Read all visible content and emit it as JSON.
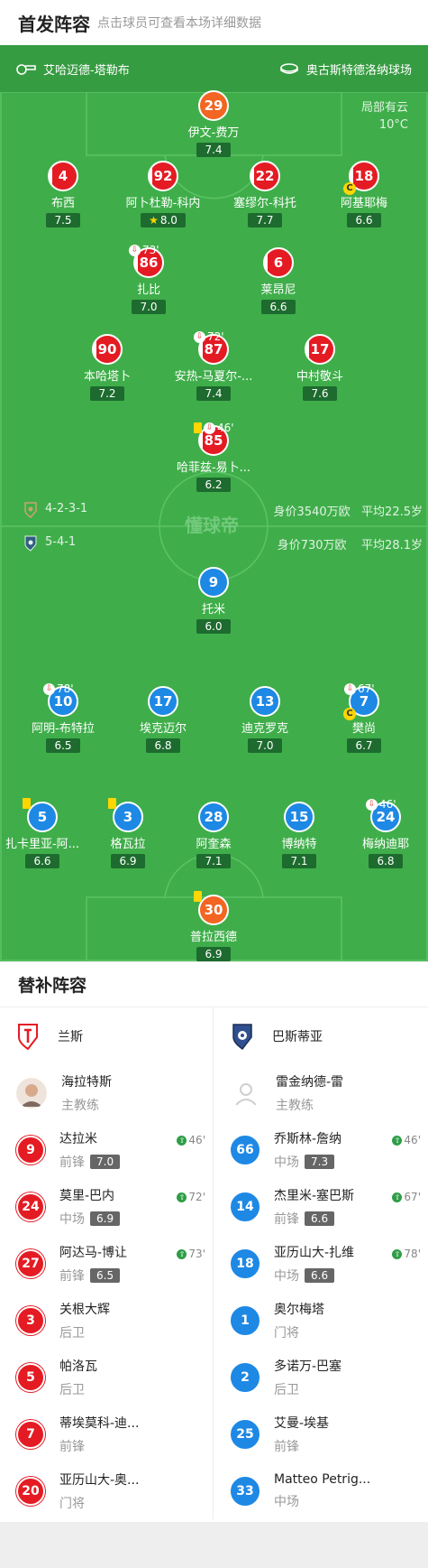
{
  "header": {
    "title": "首发阵容",
    "subtitle": "点击球员可查看本场详细数据"
  },
  "pitch": {
    "home_team": "艾哈迈德-塔勒布",
    "stadium": "奥古斯特德洛纳球场",
    "weather": "局部有云",
    "temperature": "10°C",
    "home_formation": "4-2-3-1",
    "home_value": "身价3540万欧",
    "home_avg_age": "平均22.5岁",
    "away_formation": "5-4-1",
    "away_value": "身价730万欧",
    "away_avg_age": "平均28.1岁",
    "watermark": "懂球帝"
  },
  "home_players": [
    {
      "num": "29",
      "name": "伊文-费万",
      "rating": "7.4"
    },
    {
      "num": "4",
      "name": "布西",
      "rating": "7.5"
    },
    {
      "num": "92",
      "name": "阿卜杜勒-科内",
      "rating": "8.0"
    },
    {
      "num": "22",
      "name": "塞缪尔-科托",
      "rating": "7.7"
    },
    {
      "num": "18",
      "name": "阿基耶梅",
      "rating": "6.6",
      "captain": "C"
    },
    {
      "num": "86",
      "name": "扎比",
      "rating": "7.0",
      "sub": "73'"
    },
    {
      "num": "6",
      "name": "莱昂尼",
      "rating": "6.6"
    },
    {
      "num": "90",
      "name": "本哈塔卜",
      "rating": "7.2"
    },
    {
      "num": "87",
      "name": "安热-马夏尔-...",
      "rating": "7.4",
      "sub": "72'"
    },
    {
      "num": "17",
      "name": "中村敬斗",
      "rating": "7.6"
    },
    {
      "num": "85",
      "name": "哈菲兹-易卜...",
      "rating": "6.2",
      "sub": "46'"
    }
  ],
  "away_players": [
    {
      "num": "9",
      "name": "托米",
      "rating": "6.0"
    },
    {
      "num": "10",
      "name": "阿明-布特拉",
      "rating": "6.5",
      "sub": "78'"
    },
    {
      "num": "17",
      "name": "埃克迈尔",
      "rating": "6.8"
    },
    {
      "num": "13",
      "name": "迪克罗克",
      "rating": "7.0"
    },
    {
      "num": "7",
      "name": "樊尚",
      "rating": "6.7",
      "sub": "67'",
      "captain": "C"
    },
    {
      "num": "5",
      "name": "扎卡里亚-阿...",
      "rating": "6.6"
    },
    {
      "num": "3",
      "name": "格瓦拉",
      "rating": "6.9"
    },
    {
      "num": "28",
      "name": "阿奎森",
      "rating": "7.1"
    },
    {
      "num": "15",
      "name": "博纳特",
      "rating": "7.1"
    },
    {
      "num": "24",
      "name": "梅纳迪耶",
      "rating": "6.8",
      "sub": "46'"
    },
    {
      "num": "30",
      "name": "普拉西德",
      "rating": "6.9"
    }
  ],
  "subs": {
    "title": "替补阵容",
    "home": {
      "team": "兰斯",
      "coach": "海拉特斯",
      "coach_role": "主教练",
      "players": [
        {
          "num": "9",
          "name": "达拉米",
          "pos": "前锋",
          "rating": "7.0",
          "in": "46'"
        },
        {
          "num": "24",
          "name": "莫里-巴内",
          "pos": "中场",
          "rating": "6.9",
          "in": "72'"
        },
        {
          "num": "27",
          "name": "阿达马-博让",
          "pos": "前锋",
          "rating": "6.5",
          "in": "73'"
        },
        {
          "num": "3",
          "name": "关根大辉",
          "pos": "后卫"
        },
        {
          "num": "5",
          "name": "帕洛瓦",
          "pos": "后卫"
        },
        {
          "num": "7",
          "name": "蒂埃莫科-迪...",
          "pos": "前锋"
        },
        {
          "num": "20",
          "name": "亚历山大-奥...",
          "pos": "门将"
        }
      ]
    },
    "away": {
      "team": "巴斯蒂亚",
      "coach": "雷金纳德-雷",
      "coach_role": "主教练",
      "players": [
        {
          "num": "66",
          "name": "乔斯林-詹纳",
          "pos": "中场",
          "rating": "7.3",
          "in": "46'"
        },
        {
          "num": "14",
          "name": "杰里米-塞巴斯",
          "pos": "前锋",
          "rating": "6.6",
          "in": "67'"
        },
        {
          "num": "18",
          "name": "亚历山大-扎维",
          "pos": "中场",
          "rating": "6.6",
          "in": "78'"
        },
        {
          "num": "1",
          "name": "奥尔梅塔",
          "pos": "门将"
        },
        {
          "num": "2",
          "name": "多诺万-巴塞",
          "pos": "后卫"
        },
        {
          "num": "25",
          "name": "艾曼-埃基",
          "pos": "前锋"
        },
        {
          "num": "33",
          "name": "Matteo Petrig...",
          "pos": "中场"
        }
      ]
    }
  },
  "colors": {
    "pitch": "#3fae4a",
    "home": "#e41b23",
    "away": "#1e88e5",
    "gk": "#f26522"
  }
}
